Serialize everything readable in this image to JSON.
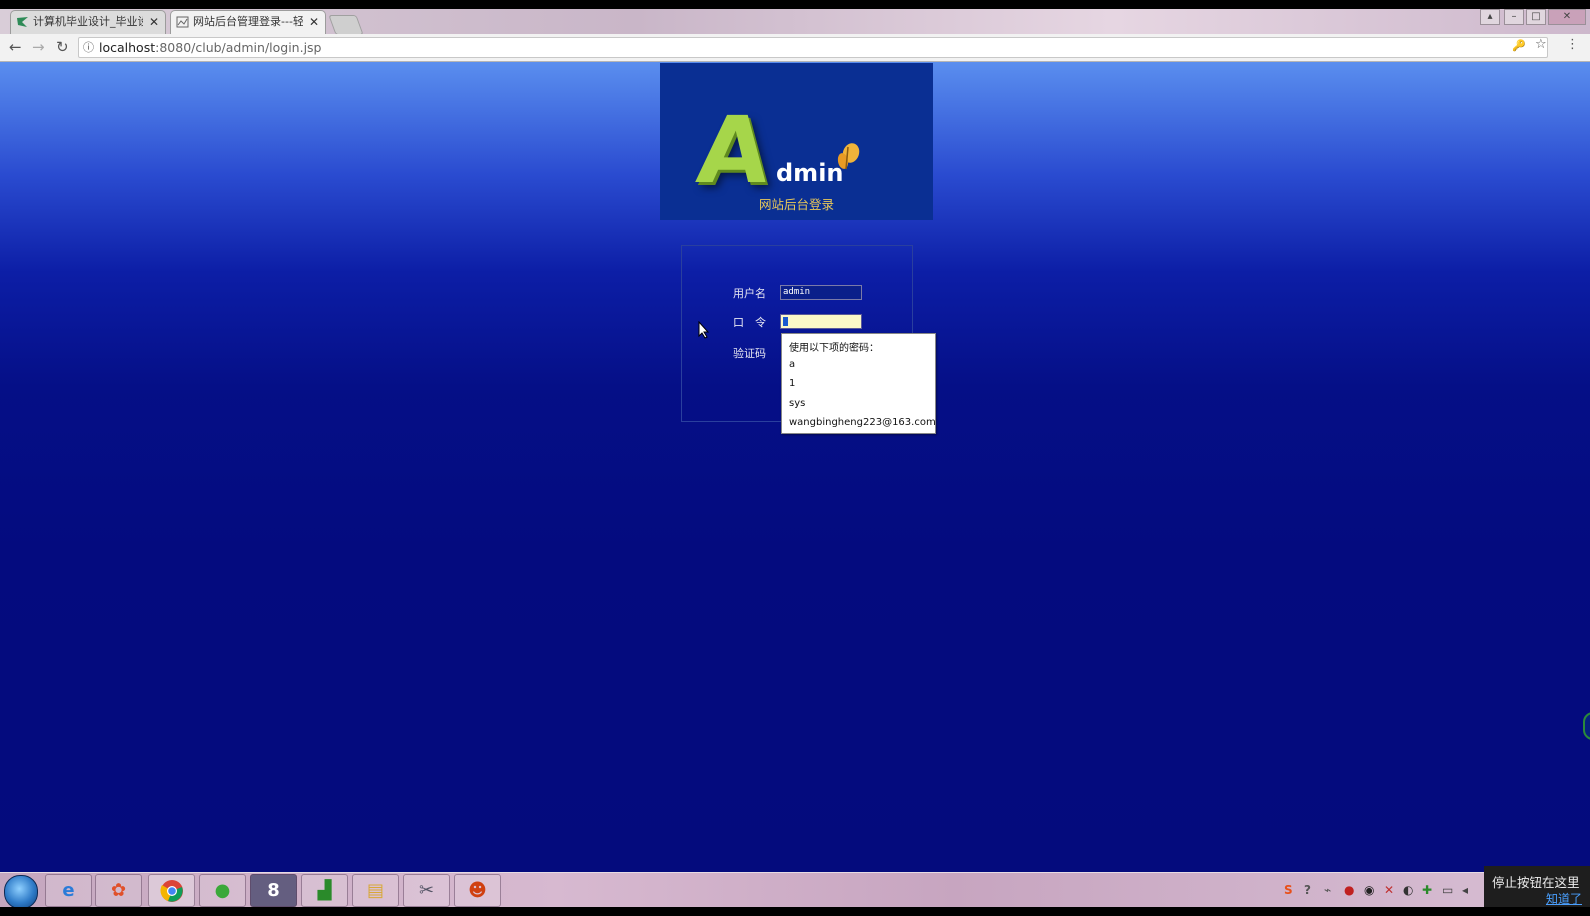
{
  "browser": {
    "tabs": [
      {
        "title": "计算机毕业设计_毕业设计",
        "active": false
      },
      {
        "title": "网站后台管理登录---轻",
        "active": true
      }
    ],
    "close_glyph": "✕",
    "url": {
      "host": "localhost",
      "path": ":8080/club/admin/login.jsp"
    },
    "icons": {
      "back": "←",
      "forward": "→",
      "reload": "↻",
      "info": "ⓘ",
      "key": "🔑",
      "star": "☆",
      "menu": "⋮"
    }
  },
  "logo": {
    "letter": "A",
    "word": "dmin",
    "subtitle": "网站后台登录"
  },
  "login": {
    "username_label": "用户名",
    "username_value": "admin",
    "password_label": "口　令",
    "captcha_label": "验证码"
  },
  "autofill": {
    "header": "使用以下项的密码：",
    "options": [
      "a",
      "1",
      "sys",
      "wangbingheng223@163.com"
    ]
  },
  "taskbar": {
    "items": [
      "IE",
      "Media",
      "Chrome",
      "Sogou",
      "Sublime",
      "Chart",
      "Folder",
      "Tools",
      "App"
    ],
    "tray": [
      "S",
      "?",
      "⌁",
      "●",
      "◉",
      "✕",
      "◐",
      "✚",
      "▭",
      "◂"
    ]
  },
  "notice": {
    "text": "停止按钮在这里",
    "link": "知道了"
  },
  "colors": {
    "accent_green": "#a6d64a",
    "subtitle_gold": "#e8c85a",
    "page_blue": "#040b7f"
  }
}
